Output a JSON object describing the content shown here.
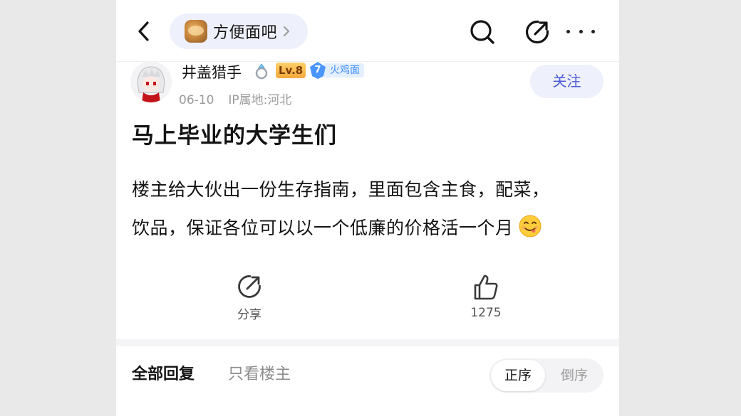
{
  "nav": {
    "forum_name": "方便面吧"
  },
  "author": {
    "name": "井盖猎手",
    "level_badge": "Lv.8",
    "fan_level": "7",
    "fan_label": "火鸡面",
    "date": "06-10",
    "ip_location": "IP属地:河北",
    "follow_label": "关注"
  },
  "post": {
    "title": "马上毕业的大学生们",
    "body_line1": "楼主给大伙出一份生存指南，里面包含主食，配菜，",
    "body_line2": "饮品，保证各位可以以一个低廉的价格活一个月"
  },
  "actions": {
    "share_label": "分享",
    "like_count": "1275"
  },
  "replies": {
    "tab_all": "全部回复",
    "tab_owner_only": "只看楼主",
    "sort_asc": "正序",
    "sort_desc": "倒序"
  },
  "colors": {
    "accent": "#4a5bd8",
    "pill_bg": "#eef0fb",
    "fan_badge": "#3f8cff",
    "level_badge": "#f3a83a"
  },
  "icons": [
    "back-arrow-icon",
    "chevron-right-icon",
    "search-icon",
    "share-icon",
    "more-icon",
    "ring-icon",
    "shield-icon",
    "smiley-tongue-icon",
    "thumbs-up-icon"
  ]
}
